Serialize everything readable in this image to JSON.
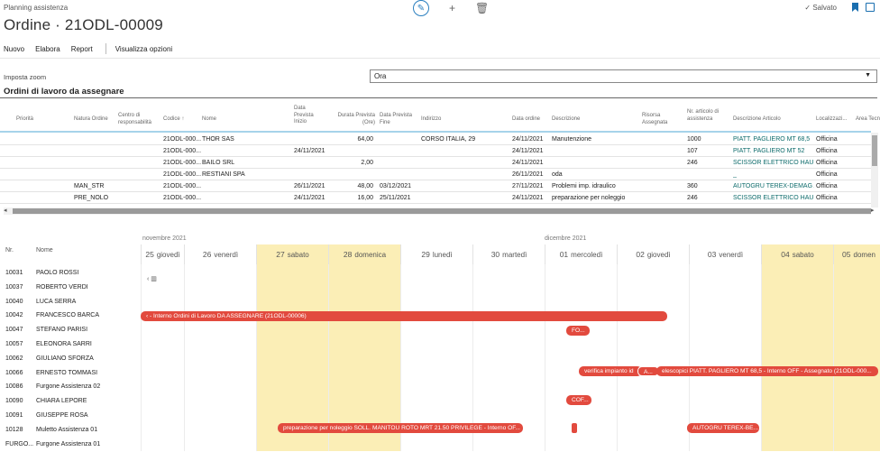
{
  "breadcrumb": "Planning assistenza",
  "title": "Ordine · 21ODL-00009",
  "status": "✓ Salvato",
  "actions": {
    "nuovo": "Nuovo",
    "elabora": "Elabora",
    "report": "Report",
    "opzioni": "Visualizza opzioni"
  },
  "zoom": {
    "label": "Imposta zoom",
    "value": "Ora"
  },
  "section": "Ordini di lavoro da assegnare",
  "columns": [
    "Priorità",
    "Natura Ordine",
    "Centro di responsabilità",
    "Codice ↑",
    "Nome",
    "Data Prevista Inizio",
    "Durata Prevista (Ore)",
    "Data Prevista Fine",
    "Indirizzo",
    "Data ordine",
    "Descrizione",
    "Risorsa Assegnata",
    "Nr. articolo di assistenza",
    "Descrizione Articolo",
    "Localizzazi...",
    "Area Tecn"
  ],
  "orders": [
    {
      "natura": "",
      "codice": "21ODL-000...",
      "nome": "THOR SAS",
      "inizio": "",
      "durata": "64,00",
      "fine": "",
      "indirizzo": "CORSO ITALIA, 29",
      "data": "24/11/2021",
      "descr": "Manutenzione",
      "nr": "1000",
      "art": "PIATT. PAGLIERO MT 68,5",
      "loc": "Officina"
    },
    {
      "natura": "",
      "codice": "21ODL-000...",
      "nome": "",
      "inizio": "24/11/2021",
      "durata": "",
      "fine": "",
      "indirizzo": "",
      "data": "24/11/2021",
      "descr": "",
      "nr": "107",
      "art": "PIATT. PAGLIERO MT 52",
      "loc": "Officina"
    },
    {
      "natura": "",
      "codice": "21ODL-000...",
      "nome": "BAILO SRL",
      "inizio": "",
      "durata": "2,00",
      "fine": "",
      "indirizzo": "",
      "data": "24/11/2021",
      "descr": "",
      "nr": "246",
      "art": "SCISSOR ELETTRICO HAULO...",
      "loc": "Officina"
    },
    {
      "natura": "",
      "codice": "21ODL-000...",
      "nome": "RESTIANI SPA",
      "inizio": "",
      "durata": "",
      "fine": "",
      "indirizzo": "",
      "data": "26/11/2021",
      "descr": "oda",
      "nr": "",
      "art": "_",
      "loc": "Officina"
    },
    {
      "natura": "MAN_STR",
      "codice": "21ODL-000...",
      "nome": "",
      "inizio": "26/11/2021",
      "durata": "48,00",
      "fine": "03/12/2021",
      "indirizzo": "",
      "data": "27/11/2021",
      "descr": "Problemi imp. idraulico",
      "nr": "360",
      "art": "AUTOGRU TEREX-DEMAG A...",
      "loc": "Officina"
    },
    {
      "natura": "PRE_NOLO",
      "codice": "21ODL-000...",
      "nome": "",
      "inizio": "24/11/2021",
      "durata": "16,00",
      "fine": "25/11/2021",
      "indirizzo": "",
      "data": "24/11/2021",
      "descr": "preparazione per noleggio",
      "nr": "246",
      "art": "SCISSOR ELETTRICO HAULO...",
      "loc": "Officina"
    }
  ],
  "gantt": {
    "hdr_nr": "Nr.",
    "hdr_nome": "Nome",
    "months": [
      "novembre 2021",
      "dicembre 2021"
    ],
    "days": [
      {
        "n": "25",
        "d": "giovedì"
      },
      {
        "n": "26",
        "d": "venerdì"
      },
      {
        "n": "27",
        "d": "sabato"
      },
      {
        "n": "28",
        "d": "domenica"
      },
      {
        "n": "29",
        "d": "lunedì"
      },
      {
        "n": "30",
        "d": "martedì"
      },
      {
        "n": "01",
        "d": "mercoledì"
      },
      {
        "n": "02",
        "d": "giovedì"
      },
      {
        "n": "03",
        "d": "venerdì"
      },
      {
        "n": "04",
        "d": "sabato"
      },
      {
        "n": "05",
        "d": "domen"
      }
    ],
    "back": "‹ ▥",
    "resources": [
      {
        "nr": "10031",
        "nome": "PAOLO ROSSI"
      },
      {
        "nr": "10037",
        "nome": "ROBERTO VERDI"
      },
      {
        "nr": "10040",
        "nome": "LUCA SERRA"
      },
      {
        "nr": "10042",
        "nome": "FRANCESCO BARCA"
      },
      {
        "nr": "10047",
        "nome": "STEFANO PARISI"
      },
      {
        "nr": "10057",
        "nome": "ELEONORA SARRI"
      },
      {
        "nr": "10062",
        "nome": "GIULIANO SFORZA"
      },
      {
        "nr": "10066",
        "nome": "ERNESTO TOMMASI"
      },
      {
        "nr": "10086",
        "nome": "Furgone Assistenza 02"
      },
      {
        "nr": "10090",
        "nome": "CHIARA LEPORE"
      },
      {
        "nr": "10091",
        "nome": "GIUSEPPE ROSA"
      },
      {
        "nr": "10128",
        "nome": "Muletto Assistenza 01"
      },
      {
        "nr": "FURGO...",
        "nome": "Furgone Assistenza 01"
      }
    ],
    "bars": {
      "b1": "‹ - Interno Ordini di Lavoro DA ASSEGNARE (21ODL-00006)",
      "b2": "FO...",
      "b3": "verifica impianto id",
      "b4": "A...",
      "b5": "elescopici PIATT. PAGLIERO MT 68,5 - Interno OFF - Assegnato (21ODL-000...",
      "b6": "COF...",
      "b7": "preparazione per noleggio SOLL. MANITOU ROTO MRT 21.50 PRIVILEGE - Interno OF...",
      "b8": "AUTOGRU TEREX-BE..."
    }
  }
}
